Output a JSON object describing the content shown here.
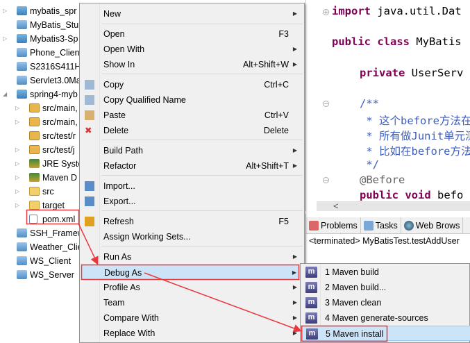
{
  "tree": [
    {
      "label": "mybatis_spr",
      "icon": "maven-project-warning-icon",
      "twisty": "collapsed",
      "indent": 0
    },
    {
      "label": "MyBatis_Stu",
      "icon": "project-icon",
      "twisty": "",
      "indent": 0
    },
    {
      "label": "Mybatis3-Sp",
      "icon": "maven-project-warning-icon",
      "twisty": "collapsed",
      "indent": 0
    },
    {
      "label": "Phone_Client",
      "icon": "project-icon",
      "twisty": "",
      "indent": 0
    },
    {
      "label": "S2316S411H",
      "icon": "project-icon",
      "twisty": "",
      "indent": 0
    },
    {
      "label": "Servlet3.0Ma",
      "icon": "project-icon",
      "twisty": "",
      "indent": 0
    },
    {
      "label": "spring4-myb",
      "icon": "maven-project-icon",
      "twisty": "expanded",
      "indent": 0
    },
    {
      "label": "src/main,",
      "icon": "package-folder-icon",
      "twisty": "collapsed",
      "indent": 1
    },
    {
      "label": "src/main,",
      "icon": "package-folder-icon",
      "twisty": "collapsed",
      "indent": 1
    },
    {
      "label": "src/test/r",
      "icon": "package-folder-icon",
      "twisty": "",
      "indent": 1
    },
    {
      "label": "src/test/j",
      "icon": "package-folder-icon",
      "twisty": "collapsed",
      "indent": 1
    },
    {
      "label": "JRE Syste",
      "icon": "library-icon",
      "twisty": "collapsed",
      "indent": 1
    },
    {
      "label": "Maven D",
      "icon": "library-icon",
      "twisty": "collapsed",
      "indent": 1
    },
    {
      "label": "src",
      "icon": "folder-icon",
      "twisty": "collapsed",
      "indent": 1
    },
    {
      "label": "target",
      "icon": "folder-icon",
      "twisty": "collapsed",
      "indent": 1
    },
    {
      "label": "pom.xml",
      "icon": "xml-file-icon",
      "twisty": "",
      "indent": 1
    },
    {
      "label": "SSH_Framew",
      "icon": "project-icon",
      "twisty": "",
      "indent": 0
    },
    {
      "label": "Weather_Clie",
      "icon": "project-icon",
      "twisty": "",
      "indent": 0
    },
    {
      "label": "WS_Client",
      "icon": "project-icon",
      "twisty": "",
      "indent": 0
    },
    {
      "label": "WS_Server",
      "icon": "project-icon",
      "twisty": "",
      "indent": 0
    }
  ],
  "editor": {
    "line1_kw": "import",
    "line1": " java.util.Dat",
    "line2_kw": "public class",
    "line2": " MyBatis",
    "line3_kw": "private",
    "line3": " UserServ",
    "c1": "/**",
    "c2": " * 这个before方法在",
    "c3": " * 所有做Junit单元测",
    "c4": " * 比如在before方法",
    "c5": " */",
    "annot": "@Before",
    "line4_kw": "public void",
    "line4": " befo",
    "scroll_left": "<"
  },
  "bottom": {
    "tabs": [
      "Problems",
      "Tasks",
      "Web Brows"
    ],
    "console": "<terminated> MyBatisTest.testAddUser"
  },
  "menu": {
    "items": [
      {
        "label": "New",
        "shortcut": "",
        "arrow": true
      },
      {
        "label": "Open",
        "shortcut": "F3",
        "arrow": false
      },
      {
        "label": "Open With",
        "shortcut": "",
        "arrow": true
      },
      {
        "label": "Show In",
        "shortcut": "Alt+Shift+W",
        "arrow": true
      },
      {
        "label": "Copy",
        "shortcut": "Ctrl+C",
        "arrow": false,
        "icon": "copy-icon"
      },
      {
        "label": "Copy Qualified Name",
        "shortcut": "",
        "arrow": false,
        "icon": "copy-qualified-icon"
      },
      {
        "label": "Paste",
        "shortcut": "Ctrl+V",
        "arrow": false,
        "icon": "paste-icon"
      },
      {
        "label": "Delete",
        "shortcut": "Delete",
        "arrow": false,
        "icon": "delete-icon"
      },
      {
        "label": "Build Path",
        "shortcut": "",
        "arrow": true
      },
      {
        "label": "Refactor",
        "shortcut": "Alt+Shift+T",
        "arrow": true
      },
      {
        "label": "Import...",
        "shortcut": "",
        "arrow": false,
        "icon": "import-icon"
      },
      {
        "label": "Export...",
        "shortcut": "",
        "arrow": false,
        "icon": "export-icon"
      },
      {
        "label": "Refresh",
        "shortcut": "F5",
        "arrow": false,
        "icon": "refresh-icon"
      },
      {
        "label": "Assign Working Sets...",
        "shortcut": "",
        "arrow": false
      },
      {
        "label": "Run As",
        "shortcut": "",
        "arrow": true
      },
      {
        "label": "Debug As",
        "shortcut": "",
        "arrow": true
      },
      {
        "label": "Profile As",
        "shortcut": "",
        "arrow": true
      },
      {
        "label": "Team",
        "shortcut": "",
        "arrow": true
      },
      {
        "label": "Compare With",
        "shortcut": "",
        "arrow": true
      },
      {
        "label": "Replace With",
        "shortcut": "",
        "arrow": true
      }
    ]
  },
  "submenu": {
    "icon_letter": "m",
    "items": [
      "1 Maven build",
      "2 Maven build...",
      "3 Maven clean",
      "4 Maven generate-sources",
      "5 Maven install"
    ]
  },
  "colors": {
    "annotation": "#e8383d",
    "highlight": "#cce4f7"
  }
}
